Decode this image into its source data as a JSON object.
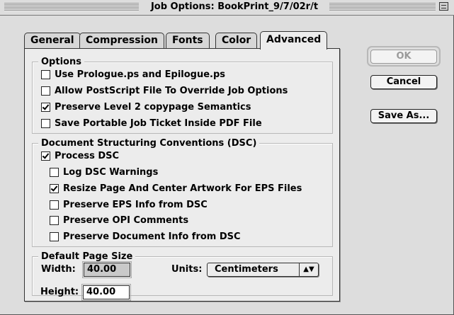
{
  "window": {
    "title": "Job Options: BookPrint_9/7/02r/t"
  },
  "tabs": [
    {
      "label": "General"
    },
    {
      "label": "Compression"
    },
    {
      "label": "Fonts"
    },
    {
      "label": "Color"
    },
    {
      "label": "Advanced",
      "active": true
    }
  ],
  "options": {
    "title": "Options",
    "items": [
      {
        "label": "Use Prologue.ps and Epilogue.ps",
        "checked": false
      },
      {
        "label": "Allow PostScript File To Override Job Options",
        "checked": false
      },
      {
        "label": "Preserve Level 2 copypage Semantics",
        "checked": true
      },
      {
        "label": "Save Portable Job Ticket Inside PDF File",
        "checked": false
      }
    ]
  },
  "dsc": {
    "title": "Document Structuring Conventions (DSC)",
    "process": {
      "label": "Process DSC",
      "checked": true
    },
    "items": [
      {
        "label": "Log DSC Warnings",
        "checked": false
      },
      {
        "label": "Resize Page And Center Artwork For EPS Files",
        "checked": true
      },
      {
        "label": "Preserve EPS Info from DSC",
        "checked": false
      },
      {
        "label": "Preserve OPI Comments",
        "checked": false
      },
      {
        "label": "Preserve Document Info from DSC",
        "checked": false
      }
    ]
  },
  "page_size": {
    "title": "Default Page Size",
    "width_label": "Width:",
    "width_value": "40.00",
    "height_label": "Height:",
    "height_value": "40.00",
    "units_label": "Units:",
    "units_value": "Centimeters"
  },
  "buttons": {
    "ok": "OK",
    "cancel": "Cancel",
    "save_as": "Save As..."
  }
}
